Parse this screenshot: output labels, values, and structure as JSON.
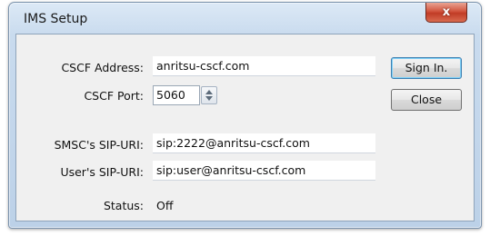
{
  "window": {
    "title": "IMS Setup",
    "close_glyph": "x"
  },
  "form": {
    "cscf_address_label": "CSCF Address:",
    "cscf_address_value": "anritsu-cscf.com",
    "cscf_port_label": "CSCF Port:",
    "cscf_port_value": "5060",
    "smsc_sip_uri_label": "SMSC's SIP-URI:",
    "smsc_sip_uri_value": "sip:2222@anritsu-cscf.com",
    "user_sip_uri_label": "User's SIP-URI:",
    "user_sip_uri_value": "sip:user@anritsu-cscf.com",
    "status_label": "Status:",
    "status_value": "Off"
  },
  "buttons": {
    "sign_in": "Sign In.",
    "close": "Close"
  },
  "colors": {
    "title_bar": "#c9dbee",
    "close_button": "#c94a34",
    "client_bg": "#f0f0f0"
  }
}
